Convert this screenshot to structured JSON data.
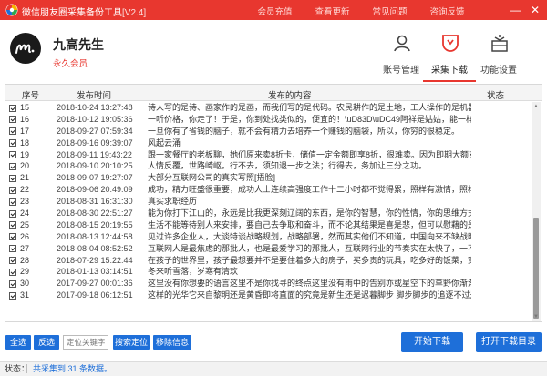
{
  "titlebar": {
    "title": "微信朋友圈采集备份工具",
    "version": "[V2.4]",
    "links": [
      "会员充值",
      "查看更新",
      "常见问题",
      "咨询反馈"
    ],
    "minimize": "—",
    "close": "✕"
  },
  "header": {
    "username": "九高先生",
    "member_level": "永久会员",
    "nav": [
      {
        "label": "账号管理",
        "icon": "user-icon"
      },
      {
        "label": "采集下载",
        "icon": "download-icon"
      },
      {
        "label": "功能设置",
        "icon": "settings-icon"
      }
    ],
    "accent": "#e8372f"
  },
  "table": {
    "columns": [
      "序号",
      "发布时间",
      "发布的内容",
      "状态"
    ],
    "rows": [
      {
        "idx": "15",
        "time": "2018-10-24 13:27:48",
        "content": "诗人写的是诗、画家作的是画，而我们写的是代码。农民耕作的是土地，工人操作的是机器，而..."
      },
      {
        "idx": "16",
        "time": "2018-10-12 19:05:36",
        "content": "一听价格，你走了！于是，你到处找类似的，便宜的！\\uD83D\\uDC49阿祥是姑姑，能一样吗？..."
      },
      {
        "idx": "17",
        "time": "2018-09-27 07:59:34",
        "content": "一旦你有了省钱的脑子，就不会有精力去培养一个赚钱的脑袋，所以，你穷的很稳定。"
      },
      {
        "idx": "18",
        "time": "2018-09-16 09:39:07",
        "content": "风起云涌"
      },
      {
        "idx": "19",
        "time": "2018-09-11 19:43:22",
        "content": "跟一家餐厅的老板聊，她们原来卖8折卡，储值一定金额即享8折，很难卖。因为即期大额支..."
      },
      {
        "idx": "20",
        "time": "2018-09-10 20:10:25",
        "content": "人情反覆，世路崎岖。行不去，须知退一步之法；行得去，务加让三分之功。"
      },
      {
        "idx": "21",
        "time": "2018-09-07 19:27:07",
        "content": "大部分互联网公司的真实写照[捂脸]"
      },
      {
        "idx": "22",
        "time": "2018-09-06 20:49:09",
        "content": "成功，精力旺盛很重要，成功人士连续高强度工作十二小时都不觉得累，照样有激情，照样有创..."
      },
      {
        "idx": "23",
        "time": "2018-08-31 16:31:30",
        "content": "真实求职经历"
      },
      {
        "idx": "24",
        "time": "2018-08-30 22:51:27",
        "content": "能为你打下江山的，永远是比我更深刻辽阔的东西，是你的智慧，你的性情，你的思维方式和你..."
      },
      {
        "idx": "25",
        "time": "2018-08-15 20:19:55",
        "content": "生活不能等待别人来安排，要自己去争取和奋斗，而不论其结果是喜是悲，但可以慰藉的是，你..."
      },
      {
        "idx": "26",
        "time": "2018-08-13 12:44:58",
        "content": "见过许多企业人，大谈特谈战略规划，战略部署，然而其实他们不知道，中国向来不缺战略家，..."
      },
      {
        "idx": "27",
        "time": "2018-08-04 08:52:52",
        "content": "互联网人是最焦虑的那批人，也是最爱学习的那批人，互联网行业的节奏实在太快了，一不留神..."
      },
      {
        "idx": "28",
        "time": "2018-07-29 15:22:44",
        "content": "在孩子的世界里，孩子最想要并不是要住着多大的房子，买多贵的玩具，吃多好的饭菜，穿多美..."
      },
      {
        "idx": "29",
        "time": "2018-01-13 03:14:51",
        "content": "冬来听雪落，岁寒有清欢"
      },
      {
        "idx": "30",
        "time": "2017-09-27 00:01:36",
        "content": "这里没有你想要的语言这里不是你找寻的终点这里没有雨中的告别亦或星空下的草野你渐渐失去..."
      },
      {
        "idx": "31",
        "time": "2017-09-18 06:12:51",
        "content": "这样的光华它来自黎明还是黄昏即将直面的究竟是新生还是迟暮脚步 脚步脚步的追逐不过是午..."
      }
    ]
  },
  "controls": {
    "select_all": "全选",
    "invert": "反选",
    "keyword_placeholder": "定位关键字",
    "search_locate": "搜索定位",
    "remove_info": "移除信息",
    "start_download": "开始下载",
    "open_dir": "打开下载目录"
  },
  "status": {
    "label": "状态：",
    "message": "共采集到 31 条数据。"
  },
  "colors": {
    "primary_blue": "#1e6fd9",
    "title_red": "#e8372f"
  }
}
